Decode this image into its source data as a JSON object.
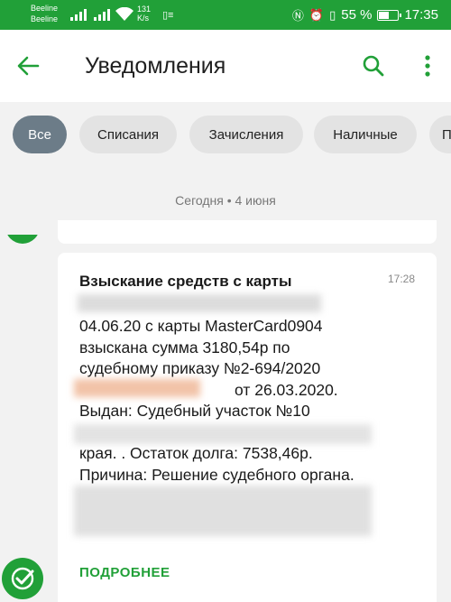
{
  "status_bar": {
    "carrier_1": "Beeline",
    "carrier_2": "Beeline",
    "speed_value": "131",
    "speed_unit": "K/s",
    "battery": "55 %",
    "battery_level": 0.55,
    "time": "17:35",
    "bar_color": "#21a038"
  },
  "app_bar": {
    "title": "Уведомления",
    "back_icon": "arrow-left-icon",
    "search_icon": "search-icon",
    "more_icon": "more-vertical-icon"
  },
  "filters": [
    {
      "label": "Все",
      "active": true
    },
    {
      "label": "Списания",
      "active": false
    },
    {
      "label": "Зачисления",
      "active": false
    },
    {
      "label": "Наличные",
      "active": false
    },
    {
      "label": "П",
      "active": false
    }
  ],
  "date_separator": "Сегодня • 4 июня",
  "notification": {
    "title": "Взыскание средств с карты",
    "time": "17:28",
    "lines": [
      "04.06.20 с карты MasterCard0904",
      "взыскана сумма 3180,54р по",
      "судебному приказу №2-694/2020",
      "от 26.03.2020.",
      "Выдан: Судебный участок №10",
      "",
      "края. . Остаток долга: 7538,46р.",
      "Причина: Решение судебного органа."
    ],
    "more_label": "ПОДРОБНЕЕ"
  },
  "colors": {
    "accent": "#21a038",
    "chip_active": "#6c7c88",
    "chip_inactive": "#e3e3e3",
    "background": "#f2f2f2"
  }
}
